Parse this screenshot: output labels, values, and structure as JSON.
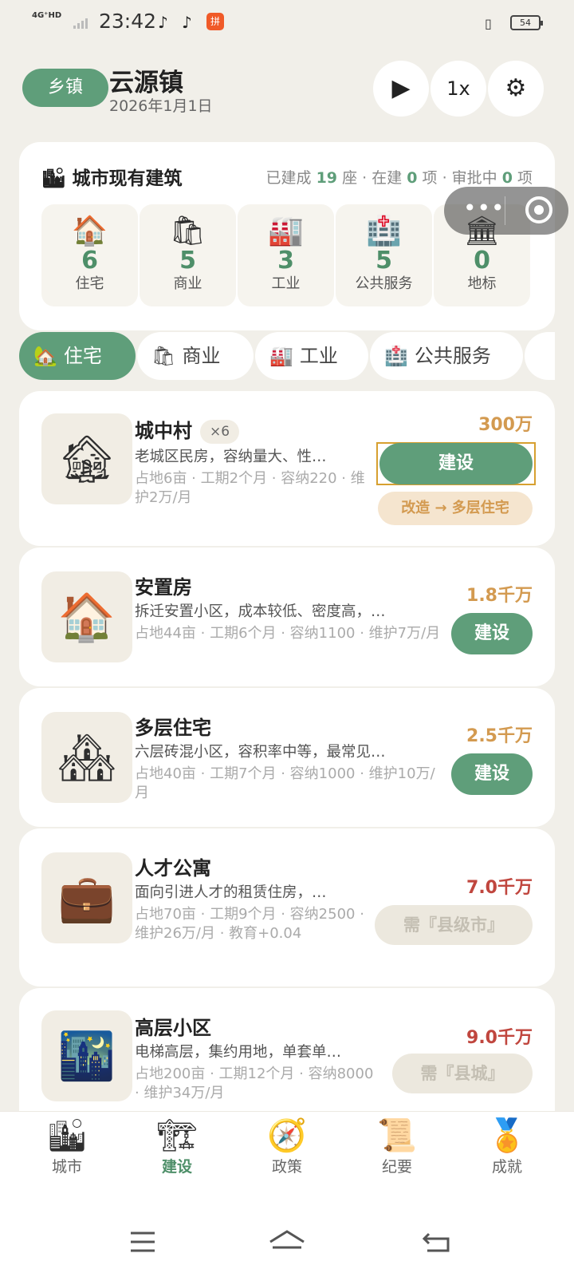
{
  "status_bar": {
    "network": "4G⁺HD",
    "time": "23:42",
    "note1": "♪",
    "note2": "♪",
    "app": "拼",
    "battery": "54"
  },
  "header": {
    "level": "乡镇",
    "town": "云源镇",
    "date": "2026年1月1日",
    "play": "▶",
    "speed": "1x",
    "settings": "⚙"
  },
  "summary": {
    "title": "城市现有建筑",
    "stats_prefix": "已建成",
    "built": "19",
    "built_unit": "座 · 在建",
    "building": "0",
    "building_unit": "项 · 审批中",
    "approving": "0",
    "approving_unit": "项",
    "categories": [
      {
        "icon": "🏠",
        "count": "6",
        "label": "住宅"
      },
      {
        "icon": "🛍",
        "count": "5",
        "label": "商业"
      },
      {
        "icon": "🏭",
        "count": "3",
        "label": "工业"
      },
      {
        "icon": "🏥",
        "count": "5",
        "label": "公共服务"
      },
      {
        "icon": "🏛",
        "count": "0",
        "label": "地标"
      }
    ]
  },
  "tabs": [
    {
      "icon": "🏡",
      "label": "住宅"
    },
    {
      "icon": "🛍",
      "label": "商业"
    },
    {
      "icon": "🏭",
      "label": "工业"
    },
    {
      "icon": "🏥",
      "label": "公共服务"
    }
  ],
  "buildings": [
    {
      "icon": "🏚",
      "name": "城中村",
      "count": "×6",
      "desc": "老城区民房，容纳量大、性…",
      "meta": "占地6亩 · 工期2个月 · 容纳220 · 维护2万/月",
      "price": "300万",
      "action": "建设",
      "upgrade": "改造 → 多层住宅"
    },
    {
      "icon": "🏠",
      "name": "安置房",
      "desc": "拆迁安置小区，成本较低、密度高，…",
      "meta": "占地44亩 · 工期6个月 · 容纳1100 · 维护7万/月",
      "price": "1.8千万",
      "action": "建设"
    },
    {
      "icon": "🏘",
      "name": "多层住宅",
      "desc": "六层砖混小区，容积率中等，最常见…",
      "meta": "占地40亩 · 工期7个月 · 容纳1000 · 维护10万/月",
      "price": "2.5千万",
      "action": "建设"
    },
    {
      "icon": "💼",
      "name": "人才公寓",
      "desc": "面向引进人才的租赁住房，…",
      "meta": "占地70亩 · 工期9个月 · 容纳2500 · 维护26万/月 · 教育+0.04",
      "price": "7.0千万",
      "action": "需『县级市』"
    },
    {
      "icon": "🌃",
      "name": "高层小区",
      "desc": "电梯高层，集约用地，单套单…",
      "meta": "占地200亩 · 工期12个月 · 容纳8000 · 维护34万/月",
      "price": "9.0千万",
      "action": "需『县城』"
    }
  ],
  "bottom_nav": [
    {
      "icon": "🏙",
      "label": "城市"
    },
    {
      "icon": "🏗",
      "label": "建设"
    },
    {
      "icon": "🧭",
      "label": "政策"
    },
    {
      "icon": "📜",
      "label": "纪要"
    },
    {
      "icon": "🏅",
      "label": "成就"
    }
  ]
}
